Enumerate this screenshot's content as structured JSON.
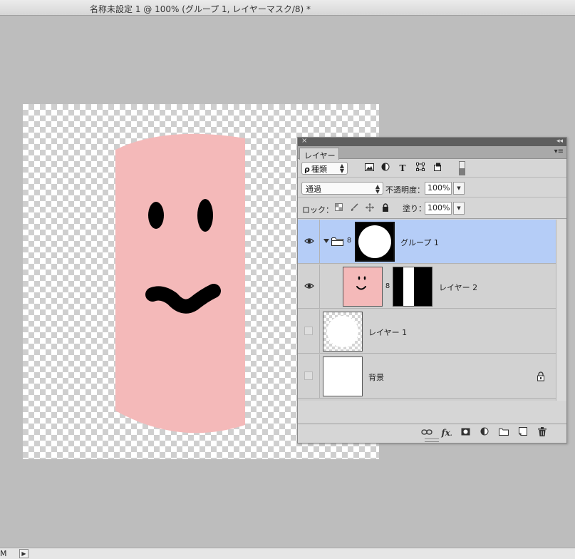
{
  "document": {
    "title": "名称未設定 1 @ 100% (グループ 1, レイヤーマスク/8) *"
  },
  "statusbar": {
    "zoom_fragment": "M",
    "menu_arrow": "▶"
  },
  "panel": {
    "close_glyph": "×",
    "collapse_glyph": "◂◂",
    "tab_label": "レイヤー",
    "menu_glyph": "▾≡",
    "filter": {
      "search_glyph": "ρ",
      "kind_label": "種類",
      "icons": [
        "image-filter-icon",
        "adjustment-filter-icon",
        "type-filter-icon",
        "shape-filter-icon",
        "smart-object-filter-icon"
      ],
      "type_glyph": "T"
    },
    "blend": {
      "mode": "通過",
      "opacity_label": "不透明度：",
      "opacity_value": "100%"
    },
    "lock": {
      "label": "ロック：",
      "fill_label": "塗り：",
      "fill_value": "100%"
    },
    "layers": [
      {
        "name": "グループ 1",
        "visible": true,
        "selected": true,
        "kind": "group-with-mask"
      },
      {
        "name": "レイヤー 2",
        "visible": true,
        "selected": false,
        "kind": "layer-with-mask"
      },
      {
        "name": "レイヤー 1",
        "visible": false,
        "selected": false,
        "kind": "layer"
      },
      {
        "name": "背景",
        "visible": false,
        "selected": false,
        "kind": "background"
      }
    ],
    "chain_glyph": "8",
    "footer": {
      "fx_label": "fx",
      "fx_suffix": "."
    }
  },
  "colors": {
    "face_pink": "#f4b9b9",
    "feature_black": "#000000",
    "selected_row": "#b5cdf7",
    "workspace_gray": "#bdbdbd"
  }
}
